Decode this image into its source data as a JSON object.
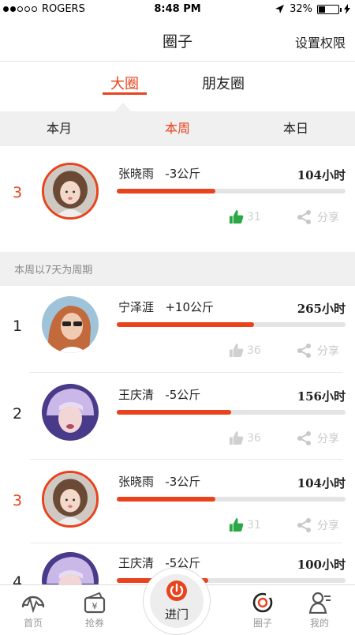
{
  "status": {
    "carrier": "ROGERS",
    "time": "8:48 PM",
    "battery": "32%",
    "battery_fraction": 0.32
  },
  "header": {
    "title": "圈子",
    "right_action": "设置权限"
  },
  "tabs": [
    {
      "label": "大圈",
      "active": true
    },
    {
      "label": "朋友圈",
      "active": false
    }
  ],
  "periods": [
    {
      "label": "本月",
      "active": false
    },
    {
      "label": "本周",
      "active": true
    },
    {
      "label": "本日",
      "active": false
    }
  ],
  "my_entry": {
    "rank": "3",
    "name": "张晓雨",
    "change": "-3公斤",
    "hours": "104小时",
    "progress": 0.43,
    "likes": "31",
    "liked": true,
    "share": "分享",
    "avatar": "girl-avatar"
  },
  "section_note": "本周以7天为周期",
  "ranking": [
    {
      "rank": "1",
      "name": "宁泽涯",
      "change": "+10公斤",
      "hours": "265小时",
      "progress": 0.6,
      "likes": "36",
      "liked": false,
      "share": "分享",
      "avatar": "sunglasses-avatar",
      "highlight": false
    },
    {
      "rank": "2",
      "name": "王庆清",
      "change": "-5公斤",
      "hours": "156小时",
      "progress": 0.5,
      "likes": "36",
      "liked": false,
      "share": "分享",
      "avatar": "purple-hair-avatar",
      "highlight": false
    },
    {
      "rank": "3",
      "name": "张晓雨",
      "change": "-3公斤",
      "hours": "104小时",
      "progress": 0.43,
      "likes": "31",
      "liked": true,
      "share": "分享",
      "avatar": "girl-avatar",
      "highlight": true
    },
    {
      "rank": "4",
      "name": "王庆清",
      "change": "-5公斤",
      "hours": "100小时",
      "progress": 0.4,
      "likes": "",
      "liked": false,
      "share": "",
      "avatar": "purple-hair-avatar",
      "highlight": false
    }
  ],
  "tabbar": {
    "home": "首页",
    "coupon": "抢券",
    "center": "进门",
    "circle": "圈子",
    "mine": "我的"
  },
  "colors": {
    "accent": "#e8431c",
    "like_active": "#2aa845",
    "inactive": "#d0d0d0"
  }
}
